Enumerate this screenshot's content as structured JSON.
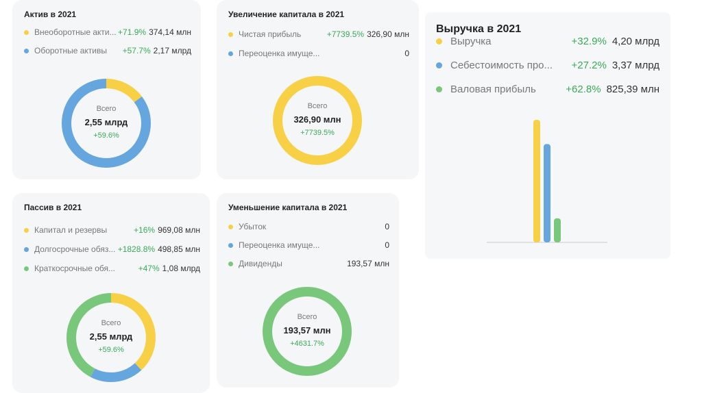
{
  "colors": {
    "yellow": "#f7d046",
    "blue": "#64a6dd",
    "green": "#79c77b",
    "pct": "#3aa957"
  },
  "cards": [
    {
      "title": "Актив в 2021",
      "items": [
        {
          "label": "Внеоборотные акти...",
          "pct": "+71.9%",
          "value": "374,14 млн",
          "color": "yellow",
          "amount": 374.14
        },
        {
          "label": "Оборотные активы",
          "pct": "+57.7%",
          "value": "2,17 млрд",
          "color": "blue",
          "amount": 2170
        }
      ],
      "total_label": "Всего",
      "total": "2,55 млрд",
      "total_pct": "+59.6%"
    },
    {
      "title": "Увеличение капитала в 2021",
      "items": [
        {
          "label": "Чистая прибыль",
          "pct": "+7739.5%",
          "value": "326,90 млн",
          "color": "yellow",
          "amount": 326.9
        },
        {
          "label": "Переоценка имуще...",
          "pct": "",
          "value": "0",
          "color": "blue",
          "amount": 0
        }
      ],
      "total_label": "Всего",
      "total": "326,90 млн",
      "total_pct": "+7739.5%"
    },
    {
      "title": "Пассив в 2021",
      "items": [
        {
          "label": "Капитал и резервы",
          "pct": "+16%",
          "value": "969,08 млн",
          "color": "yellow",
          "amount": 969.08
        },
        {
          "label": "Долгосрочные обяз...",
          "pct": "+1828.8%",
          "value": "498,85 млн",
          "color": "blue",
          "amount": 498.85
        },
        {
          "label": "Краткосрочные обя...",
          "pct": "+47%",
          "value": "1,08 млрд",
          "color": "green",
          "amount": 1080
        }
      ],
      "total_label": "Всего",
      "total": "2,55 млрд",
      "total_pct": "+59.6%"
    },
    {
      "title": "Уменьшение капитала в 2021",
      "items": [
        {
          "label": "Убыток",
          "pct": "",
          "value": "0",
          "color": "yellow",
          "amount": 0
        },
        {
          "label": "Переоценка имуще...",
          "pct": "",
          "value": "0",
          "color": "blue",
          "amount": 0
        },
        {
          "label": "Дивиденды",
          "pct": "",
          "value": "193,57 млн",
          "color": "green",
          "amount": 193.57
        }
      ],
      "total_label": "Всего",
      "total": "193,57 млн",
      "total_pct": "+4631.7%"
    }
  ],
  "revenue": {
    "title": "Выручка в 2021",
    "items": [
      {
        "label": "Выручка",
        "pct": "+32.9%",
        "value": "4,20 млрд",
        "color": "yellow"
      },
      {
        "label": "Себестоимость про...",
        "pct": "+27.2%",
        "value": "3,37 млрд",
        "color": "blue"
      },
      {
        "label": "Валовая прибыль",
        "pct": "+62.8%",
        "value": "825,39 млн",
        "color": "green"
      }
    ]
  },
  "chart_data": {
    "type": "bar",
    "title": "Выручка в 2021",
    "categories": [
      "Выручка",
      "Себестоимость про...",
      "Валовая прибыль"
    ],
    "values": [
      4.2,
      3.37,
      0.825
    ],
    "unit": "млрд",
    "ylim": [
      0,
      4.5
    ]
  }
}
